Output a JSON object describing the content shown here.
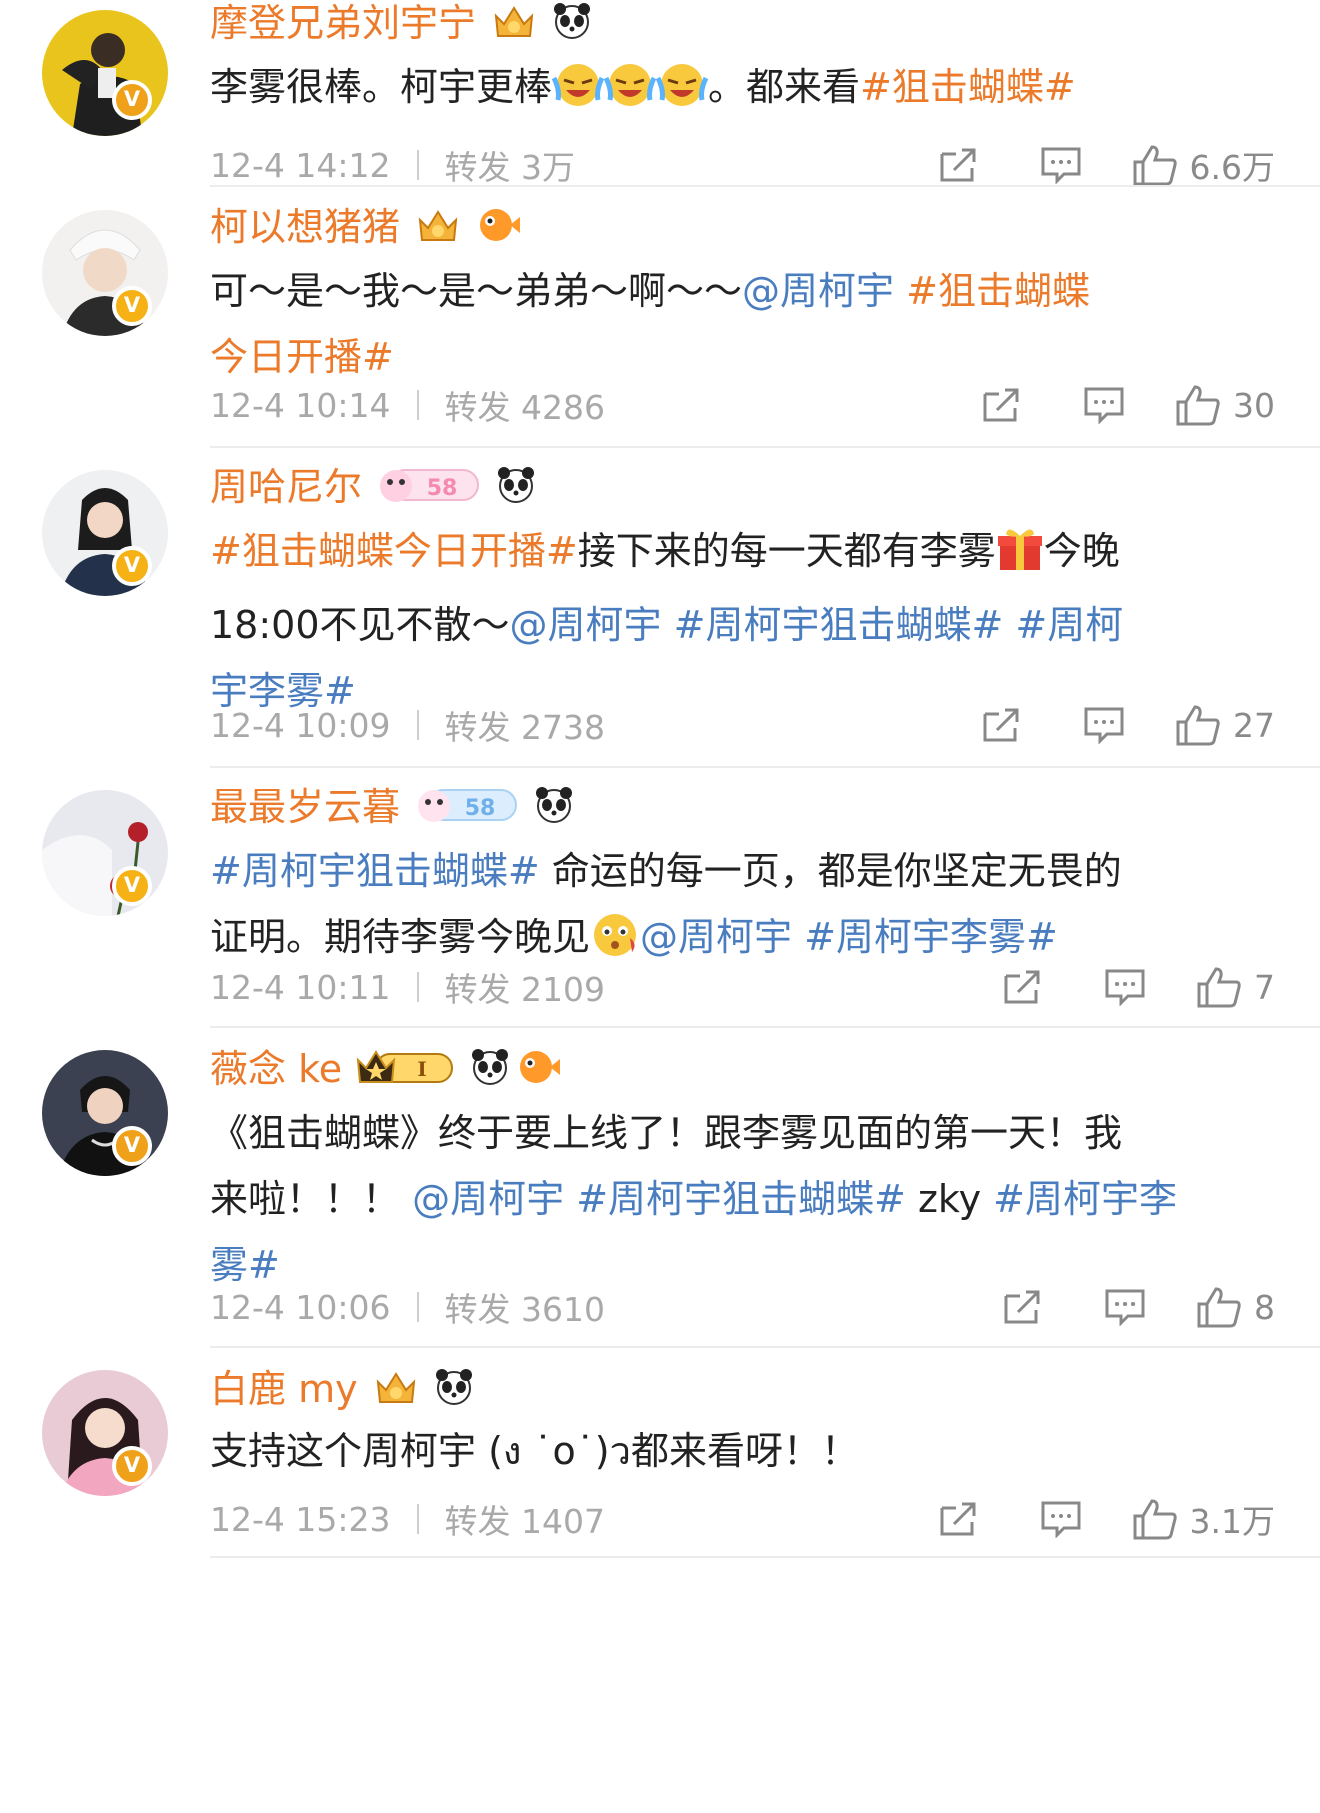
{
  "posts": [
    {
      "username": "摩登兄弟刘宇宁",
      "time": "12-4 14:12",
      "repost": "转发 3万",
      "likes": "6.6万",
      "content": {
        "t1": "李雾很棒。柯宇更棒",
        "t2": "。都来看",
        "tag1": "#狙击蝴蝶#"
      }
    },
    {
      "username": "柯以想猪猪",
      "time": "12-4 10:14",
      "repost": "转发 4286",
      "likes": "30",
      "content": {
        "t1": "可～是～我～是～弟弟～啊～～",
        "mention": "@周柯宇",
        "tag1": "#狙击蝴蝶",
        "tag2": "今日开播#"
      }
    },
    {
      "username": "周哈尼尔",
      "time": "12-4 10:09",
      "repost": "转发 2738",
      "likes": "27",
      "content": {
        "tag1": "#狙击蝴蝶今日开播#",
        "t1": "接下来的每一天都有李雾",
        "t2": "今晚",
        "t3": "18:00不见不散～",
        "mention": "@周柯宇",
        "topic1": "#周柯宇狙击蝴蝶#",
        "topic2a": "#周柯",
        "topic2b": "宇李雾#"
      }
    },
    {
      "username": "最最岁云暮",
      "time": "12-4 10:11",
      "repost": "转发 2109",
      "likes": "7",
      "content": {
        "topic1": "#周柯宇狙击蝴蝶#",
        "t1": " 命运的每一页，都是你坚定无畏的",
        "t2": "证明。期待李雾今晚见",
        "mention": "@周柯宇",
        "topic2": "#周柯宇李雾#"
      }
    },
    {
      "username": "薇念 ke",
      "time": "12-4 10:06",
      "repost": "转发 3610",
      "likes": "8",
      "content": {
        "t1": "《狙击蝴蝶》终于要上线了！跟李雾见面的第一天！我",
        "t2": "来啦！！！",
        "mention": "@周柯宇",
        "topic1": "#周柯宇狙击蝴蝶#",
        "t3": " zky ",
        "topic2a": "#周柯宇李",
        "topic2b": "雾#"
      }
    },
    {
      "username": "白鹿 my",
      "time": "12-4 15:23",
      "repost": "转发 1407",
      "likes": "3.1万",
      "content": {
        "t1": "支持这个周柯宇 (ง ˙o˙)ว都来看呀！！"
      }
    }
  ],
  "badges": {
    "level_58": "58",
    "level_1": "I"
  },
  "colors": {
    "username": "#eb7a2a",
    "hashtag_orange": "#eb7a2a",
    "link_blue": "#4a7dbf",
    "meta_gray": "#a9a9a9",
    "verified_gold": "#f6b215"
  }
}
